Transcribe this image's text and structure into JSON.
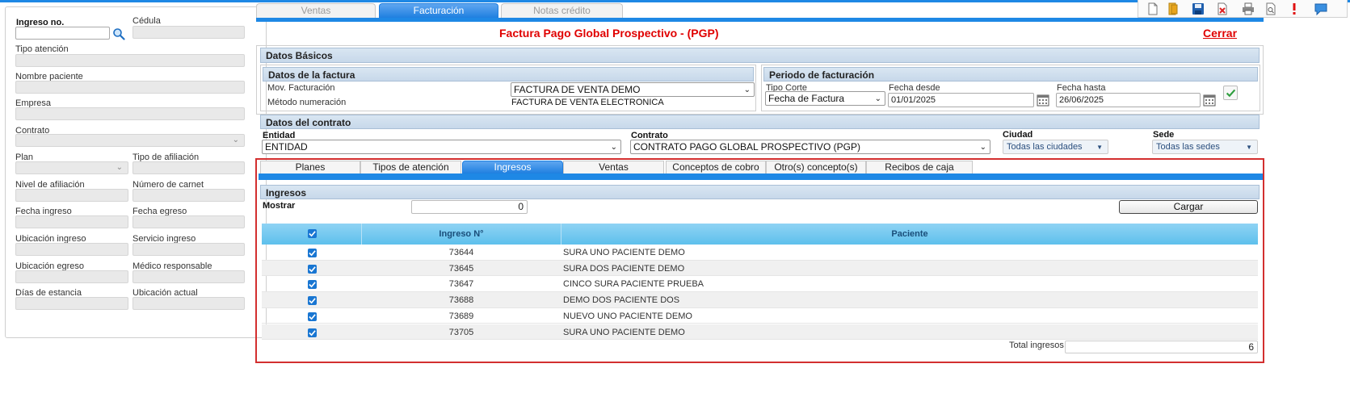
{
  "left_panel": {
    "ingreso_label": "Ingreso no.",
    "ingreso_value": "",
    "cedula_label": "Cédula",
    "tipo_atencion_label": "Tipo atención",
    "nombre_paciente_label": "Nombre paciente",
    "empresa_label": "Empresa",
    "contrato_label": "Contrato",
    "plan_label": "Plan",
    "tipo_afiliacion_label": "Tipo de afiliación",
    "nivel_afiliacion_label": "Nivel de afiliación",
    "numero_carnet_label": "Número de carnet",
    "fecha_ingreso_label": "Fecha ingreso",
    "fecha_egreso_label": "Fecha egreso",
    "ubicacion_ingreso_label": "Ubicación ingreso",
    "servicio_ingreso_label": "Servicio ingreso",
    "ubicacion_egreso_label": "Ubicación egreso",
    "medico_responsable_label": "Médico responsable",
    "dias_estancia_label": "Días de estancia",
    "ubicacion_actual_label": "Ubicación actual"
  },
  "main_tabs": [
    "Ventas",
    "Facturación",
    "Notas crédito"
  ],
  "header": {
    "title": "Factura Pago Global Prospectivo - (PGP)",
    "close_label": "Cerrar"
  },
  "datos_basicos": {
    "title": "Datos Básicos",
    "factura": {
      "title": "Datos de la factura",
      "mov_label": "Mov. Facturación",
      "mov_value": "FACTURA DE VENTA DEMO",
      "metodo_label": "Método numeración",
      "metodo_value": "FACTURA DE VENTA ELECTRONICA"
    },
    "periodo": {
      "title": "Periodo de facturación",
      "tipo_corte_label": "Tipo Corte",
      "tipo_corte_value": "Fecha de Factura",
      "fecha_desde_label": "Fecha desde",
      "fecha_desde_value": "01/01/2025",
      "fecha_hasta_label": "Fecha hasta",
      "fecha_hasta_value": "26/06/2025"
    }
  },
  "contrato": {
    "title": "Datos del contrato",
    "entidad_label": "Entidad",
    "entidad_value": "ENTIDAD",
    "contrato_label": "Contrato",
    "contrato_value": "CONTRATO PAGO GLOBAL PROSPECTIVO (PGP)",
    "ciudad_label": "Ciudad",
    "ciudad_value": "Todas las ciudades",
    "sede_label": "Sede",
    "sede_value": "Todas las sedes"
  },
  "sub_tabs": [
    "Planes",
    "Tipos de atención",
    "Ingresos",
    "Ventas",
    "Conceptos de cobro",
    "Otro(s) concepto(s)",
    "Recibos de caja"
  ],
  "ingresos": {
    "title": "Ingresos",
    "mostrar_label": "Mostrar",
    "mostrar_value": "0",
    "cargar_label": "Cargar",
    "col_ingreso": "Ingreso N°",
    "col_paciente": "Paciente",
    "rows": [
      {
        "ingreso": "73644",
        "paciente": "SURA UNO PACIENTE DEMO"
      },
      {
        "ingreso": "73645",
        "paciente": "SURA DOS PACIENTE DEMO"
      },
      {
        "ingreso": "73647",
        "paciente": "CINCO SURA PACIENTE PRUEBA"
      },
      {
        "ingreso": "73688",
        "paciente": "DEMO DOS PACIENTE DOS"
      },
      {
        "ingreso": "73689",
        "paciente": "NUEVO UNO PACIENTE DEMO"
      },
      {
        "ingreso": "73705",
        "paciente": "SURA UNO PACIENTE DEMO"
      }
    ],
    "total_label": "Total ingresos",
    "total_value": "6"
  },
  "colors": {
    "accent": "#1e88e5",
    "title_red": "#e00000",
    "frame_red": "#d32f2f"
  }
}
